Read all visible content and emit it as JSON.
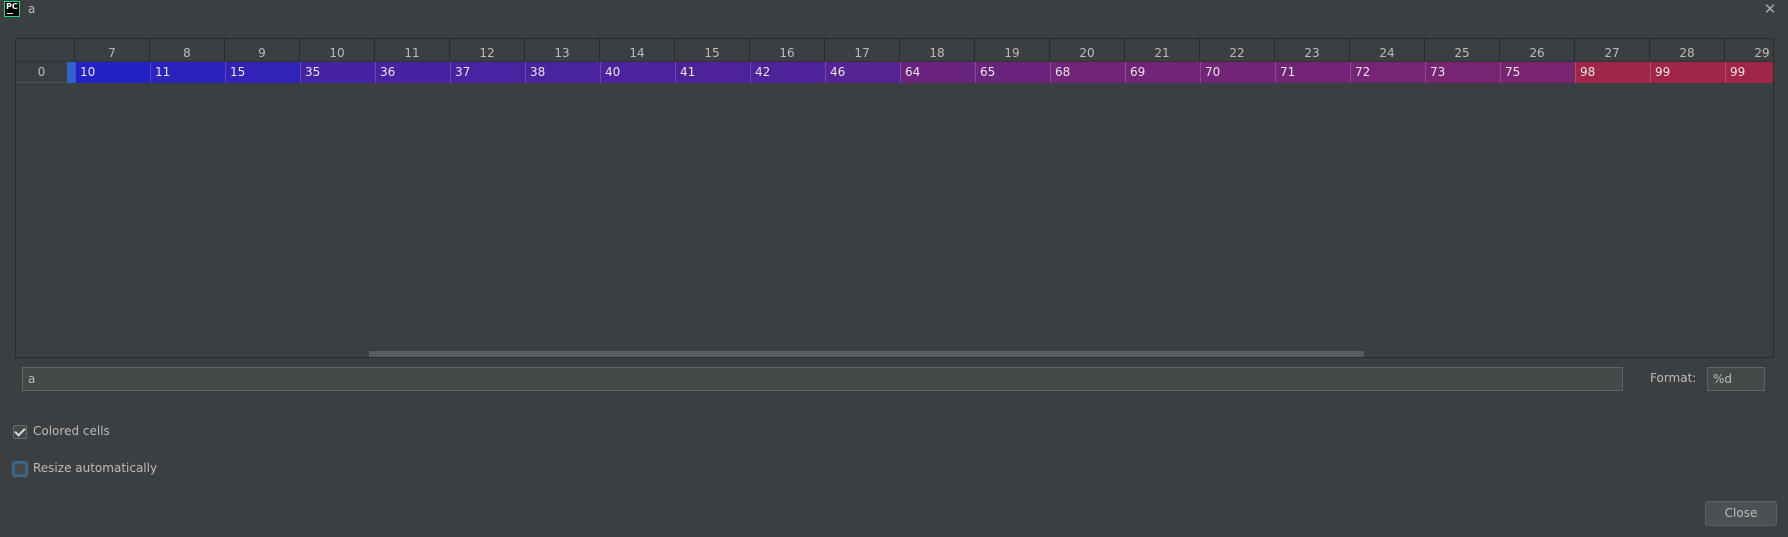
{
  "window": {
    "title": "a",
    "app_icon_text": "PC",
    "close_glyph": "✕"
  },
  "grid": {
    "column_headers": [
      "7",
      "8",
      "9",
      "10",
      "11",
      "12",
      "13",
      "14",
      "15",
      "16",
      "17",
      "18",
      "19",
      "20",
      "21",
      "22",
      "23",
      "24",
      "25",
      "26",
      "27",
      "28",
      "29"
    ],
    "rows": [
      {
        "index": "0",
        "cells": [
          "10",
          "11",
          "15",
          "35",
          "36",
          "37",
          "38",
          "40",
          "41",
          "42",
          "46",
          "64",
          "65",
          "68",
          "69",
          "70",
          "71",
          "72",
          "73",
          "75",
          "98",
          "99",
          "99"
        ]
      }
    ],
    "cell_colors": [
      "#2222c6",
      "#2c22bc",
      "#3222b5",
      "#4623a4",
      "#4723a2",
      "#4923a1",
      "#4a239f",
      "#4c239c",
      "#4e239a",
      "#4f2399",
      "#552394",
      "#6a2480",
      "#6b247e",
      "#70247a",
      "#712479",
      "#722478",
      "#742476",
      "#762475",
      "#772473",
      "#792471",
      "#a0254a",
      "#a12549",
      "#a12549"
    ],
    "scroll_position": 0.35
  },
  "expression": {
    "value": "a"
  },
  "format": {
    "label": "Format:",
    "value": "%d"
  },
  "options": {
    "colored_cells": {
      "label": "Colored cells",
      "checked": true
    },
    "resize_automatically": {
      "label": "Resize automatically",
      "checked": false
    }
  },
  "buttons": {
    "close_label": "Close"
  }
}
